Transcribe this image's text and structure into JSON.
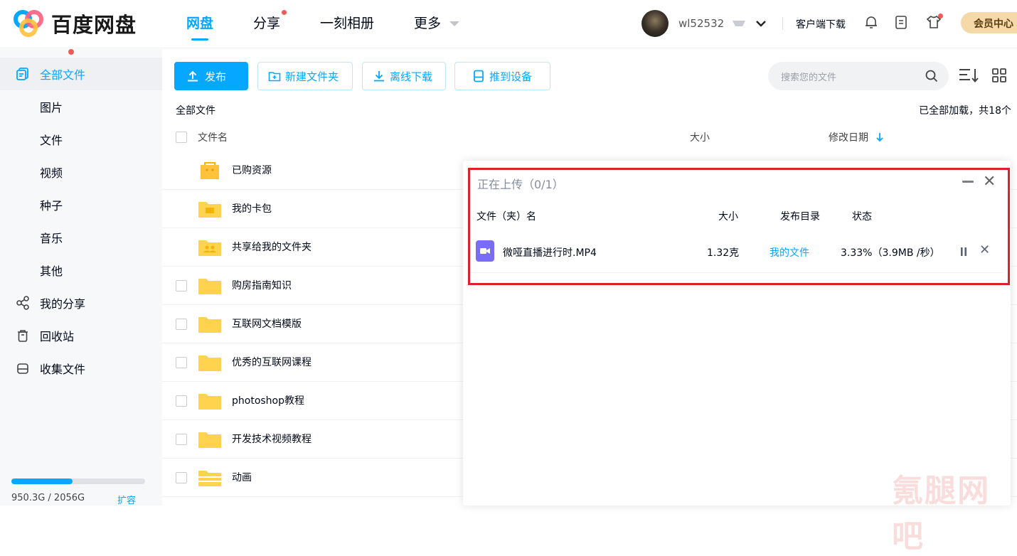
{
  "brand": {
    "name": "百度网盘",
    "accent": "#06a7ff"
  },
  "nav": {
    "items": [
      {
        "label": "网盘"
      },
      {
        "label": "分享"
      },
      {
        "label": "一刻相册"
      },
      {
        "label": "更多"
      }
    ]
  },
  "header": {
    "username": "wl52532",
    "client_download": "客户端下载",
    "vip": "会员中心"
  },
  "toolbar": {
    "publish": "发布",
    "new_folder": "新建文件夹",
    "offline_download": "离线下载",
    "push_device": "推到设备",
    "search_placeholder": "搜索您的文件"
  },
  "sidebar": {
    "items": [
      {
        "label": "全部文件",
        "icon": "files-icon"
      },
      {
        "label": "图片"
      },
      {
        "label": "文件"
      },
      {
        "label": "视频"
      },
      {
        "label": "种子"
      },
      {
        "label": "音乐"
      },
      {
        "label": "其他"
      },
      {
        "label": "我的分享",
        "icon": "share-icon"
      },
      {
        "label": "回收站",
        "icon": "trash-icon"
      },
      {
        "label": "收集文件",
        "icon": "collect-icon"
      }
    ],
    "quota_text": "950.3G / 2056G",
    "quota_fraction": 0.46,
    "expand": "扩容"
  },
  "list": {
    "breadcrumb": "全部文件",
    "loaded": "已全部加载，共18个",
    "columns": {
      "name": "文件名",
      "size": "大小",
      "modified": "修改日期"
    },
    "rows": [
      {
        "name": "已购资源"
      },
      {
        "name": "我的卡包"
      },
      {
        "name": "共享给我的文件夹"
      },
      {
        "name": "购房指南知识"
      },
      {
        "name": "互联网文档模版"
      },
      {
        "name": "优秀的互联网课程"
      },
      {
        "name": "photoshop教程"
      },
      {
        "name": "开发技术视频教程"
      },
      {
        "name": "动画"
      }
    ]
  },
  "upload": {
    "title": "正在上传（0/1）",
    "columns": {
      "name": "文件（夹）名",
      "size": "大小",
      "dir": "发布目录",
      "status": "状态"
    },
    "item": {
      "name": "微哑直播进行时.MP4",
      "size": "1.32克",
      "dir": "我的文件",
      "status": "3.33%（3.9MB /秒）"
    }
  },
  "watermark": "氪腿网吧"
}
